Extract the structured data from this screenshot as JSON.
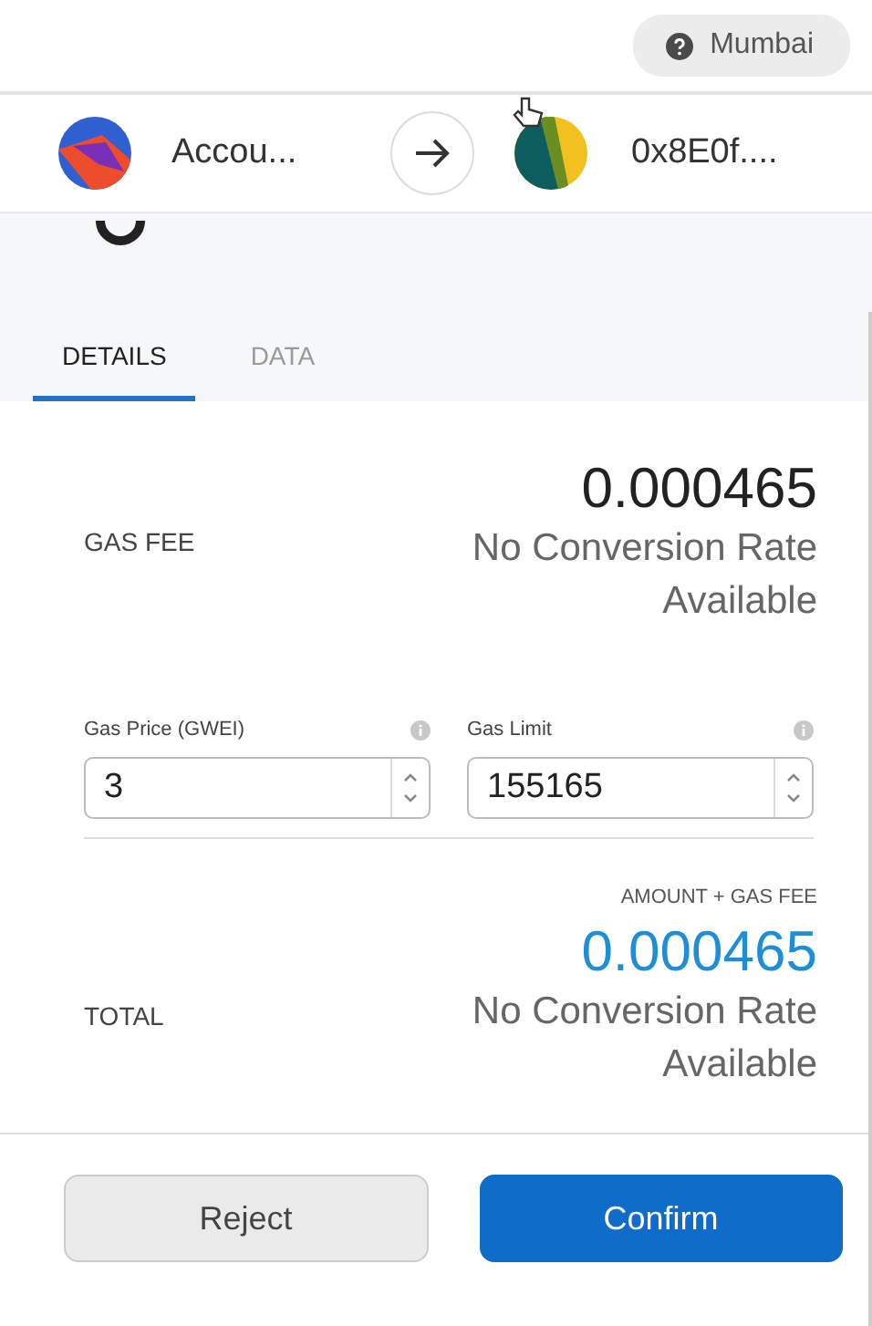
{
  "network": {
    "label": "Mumbai"
  },
  "from": {
    "name": "Accou..."
  },
  "to": {
    "address": "0x8E0f...."
  },
  "tabs": [
    {
      "label": "DETAILS",
      "selected": true
    },
    {
      "label": "DATA",
      "selected": false
    }
  ],
  "gas_fee": {
    "label": "GAS FEE",
    "amount": "0.000465",
    "conversion": "No Conversion Rate Available"
  },
  "fields": [
    {
      "label": "Gas Price (GWEI)",
      "value": "3"
    },
    {
      "label": "Gas Limit",
      "value": "155165"
    }
  ],
  "total": {
    "label": "TOTAL",
    "caption": "AMOUNT + GAS FEE",
    "amount": "0.000465",
    "conversion": "No Conversion Rate Available"
  },
  "buttons": [
    {
      "label": "Reject",
      "kind": "secondary"
    },
    {
      "label": "Confirm",
      "kind": "primary"
    }
  ]
}
